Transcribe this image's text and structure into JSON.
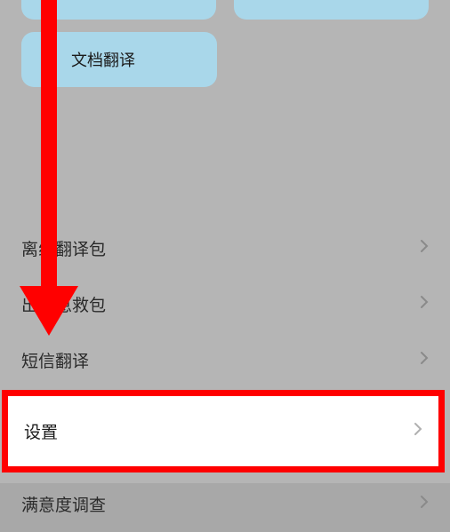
{
  "cards": {
    "doc_translate": {
      "label": "文档翻译",
      "icon": "document-icon"
    }
  },
  "menu": {
    "items": [
      {
        "label": "离线翻译包"
      },
      {
        "label": "出国急救包"
      },
      {
        "label": "短信翻译"
      },
      {
        "label": "设置"
      },
      {
        "label": "满意度调查"
      }
    ]
  },
  "annotation": {
    "type": "red-arrow",
    "target_index": 3
  }
}
